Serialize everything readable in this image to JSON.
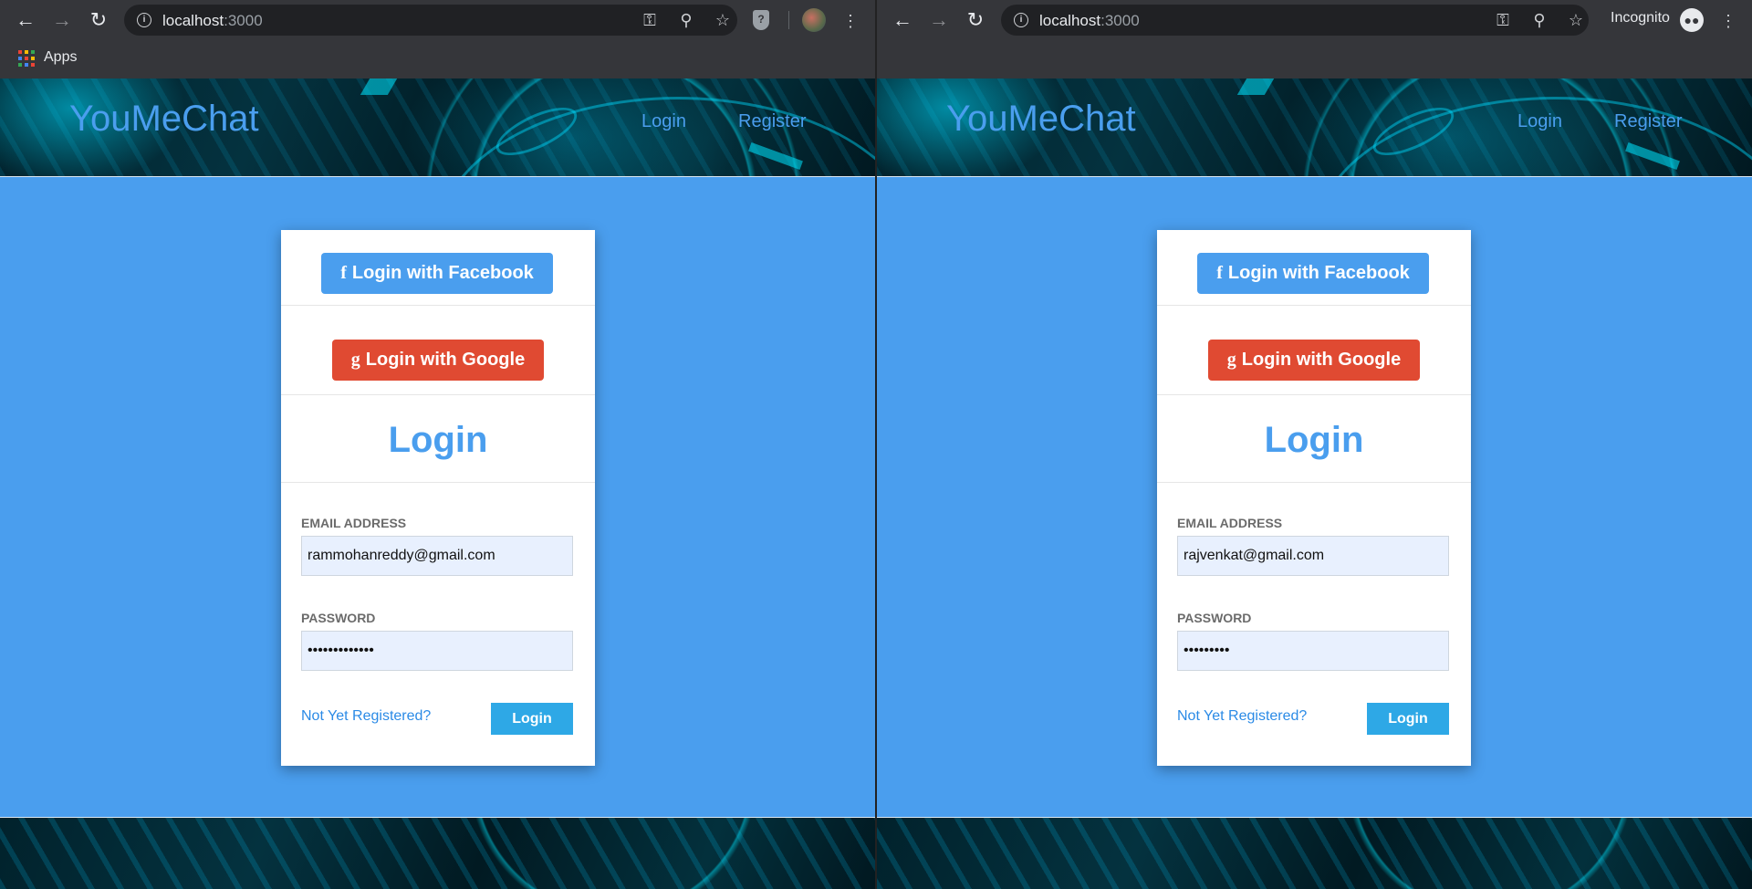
{
  "browser": {
    "url_host": "localhost",
    "url_port": ":3000",
    "bookmarks_apps_label": "Apps",
    "incognito_label": "Incognito",
    "incognito_icon": "incognito-icon",
    "profile_icon": "avatar"
  },
  "site": {
    "brand": "YouMeChat",
    "nav": {
      "login": "Login",
      "register": "Register"
    },
    "accent_color": "#4a9eee"
  },
  "form": {
    "facebook_button": "Login with Facebook",
    "google_button": "Login with Google",
    "title": "Login",
    "email_label": "EMAIL ADDRESS",
    "password_label": "PASSWORD",
    "register_link": "Not Yet Registered?",
    "submit": "Login",
    "facebook_color": "#4a9eee",
    "google_color": "#e04a32"
  },
  "windows": {
    "left": {
      "email": "rammohanreddy@gmail.com",
      "password": "•••••••••••••"
    },
    "right": {
      "email": "rajvenkat@gmail.com",
      "password": "•••••••••"
    }
  }
}
